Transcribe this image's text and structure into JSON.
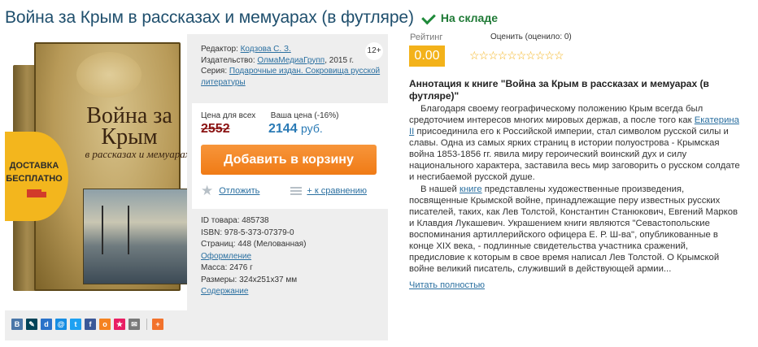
{
  "header": {
    "title": "Война за Крым в рассказах и мемуарах (в футляре)",
    "stock": "На складе"
  },
  "image": {
    "book_title": "Война за Крым",
    "book_subtitle": "в рассказах и мемуарах",
    "promo_line1": "ДОСТАВКА",
    "promo_line2": "БЕСПЛАТНО"
  },
  "meta": {
    "age": "12+",
    "editor_label": "Редактор:",
    "editor": "Кодзова С. З.",
    "publisher_label": "Издательство:",
    "publisher": "ОлмаМедиаГрупп",
    "year": ", 2015 г.",
    "series_label": "Серия:",
    "series": "Подарочные издан. Сокровища русской литературы"
  },
  "price": {
    "all_label": "Цена для всех",
    "your_label": "Ваша цена (-16%)",
    "old": "2552",
    "new": "2144",
    "currency": "руб.",
    "add_to_cart": "Добавить в корзину",
    "defer": "Отложить",
    "compare": "+ к сравнению"
  },
  "specs": {
    "id": "ID товара: 485738",
    "isbn": "ISBN: 978-5-373-07379-0",
    "pages": "Страниц: 448 (Мелованная)",
    "design": "Оформление",
    "weight": "Масса: 2476 г",
    "size": "Размеры: 324x251x37 мм",
    "contents": "Содержание"
  },
  "social": {
    "icons": [
      "vk-icon",
      "livejournal-icon",
      "delicious-icon",
      "mail-icon",
      "twitter-icon",
      "facebook-icon",
      "odnoklassniki-icon",
      "bookmark-icon",
      "email-icon",
      "plus-icon"
    ],
    "colors": [
      "#4a76a8",
      "#004359",
      "#2a72c9",
      "#168de2",
      "#1da1f2",
      "#3b5998",
      "#f58220",
      "#e91e63",
      "#7a7a7a",
      "#f2722c"
    ],
    "glyphs": [
      "В",
      "✎",
      "d",
      "@",
      "t",
      "f",
      "o",
      "★",
      "✉",
      "+"
    ]
  },
  "rating": {
    "label": "Рейтинг",
    "value": "0.00",
    "rate_label": "Оценить (оценило: 0)",
    "stars": "☆☆☆☆☆☆☆☆☆☆",
    "stars_count": 10
  },
  "annotation": {
    "title": "Аннотация к книге \"Война за Крым в рассказах и мемуарах (в футляре)\"",
    "p1_before": "Благодаря своему географическому положению Крым всегда был средоточием интересов многих мировых держав, а после того как ",
    "p1_link": "Екатерина II",
    "p1_after": " присоединила его к Российской империи, стал символом русской силы и славы. Одна из самых ярких страниц в истории полуострова - Крымская война 1853-1856 гг. явила миру героический воинский дух и силу национального характера, заставила весь мир заговорить о русском солдате и несгибаемой русской душе.",
    "p2_before": "В нашей ",
    "p2_link": "книге",
    "p2_after": " представлены художественные произведения, посвященные Крымской войне, принадлежащие перу известных русских писателей, таких, как Лев Толстой, Константин Станюкович, Евгений Марков и Клавдия Лукашевич. Украшением книги являются \"Севастопольские воспоминания артиллерийского офицера Е. Р. Ш-ва\", опубликованные в конце XIX века, - подлинные свидетельства участника сражений, предисловие к которым в свое время написал Лев Толстой. О Крымской войне великий писатель, служивший в действующей армии...",
    "read_more": "Читать полностью"
  }
}
